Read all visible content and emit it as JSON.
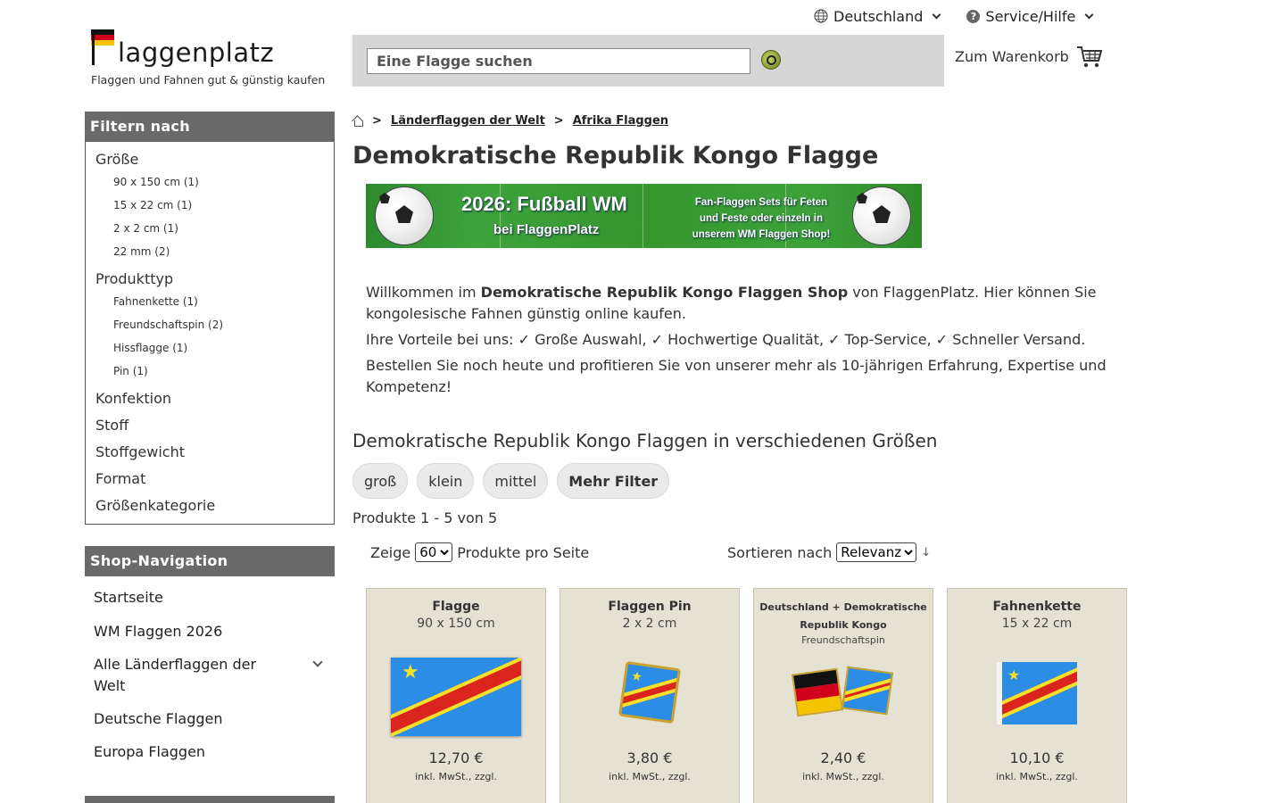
{
  "header": {
    "country_label": "Deutschland",
    "service_label": "Service/Hilfe",
    "help_glyph": "?",
    "logo_word": "laggenplatz",
    "logo_tagline": "Flaggen und Fahnen gut & günstig kaufen",
    "search_placeholder": "Eine Flagge suchen",
    "cart_label": "Zum Warenkorb"
  },
  "sidebar": {
    "filter_title": "Filtern nach",
    "filters": [
      {
        "label": "Größe",
        "options": [
          "90 x 150 cm (1)",
          "15 x 22 cm (1)",
          "2 x 2 cm (1)",
          "22 mm (2)"
        ]
      },
      {
        "label": "Produkttyp",
        "options": [
          "Fahnenkette (1)",
          "Freundschaftspin (2)",
          "Hissflagge (1)",
          "Pin (1)"
        ]
      },
      {
        "label": "Konfektion"
      },
      {
        "label": "Stoff"
      },
      {
        "label": "Stoffgewicht"
      },
      {
        "label": "Format"
      },
      {
        "label": "Größenkategorie"
      }
    ],
    "nav_title": "Shop-Navigation",
    "nav_items": [
      "Startseite",
      "WM Flaggen 2026",
      "Alle Länderflaggen der Welt",
      "Deutsche Flaggen",
      "Europa Flaggen"
    ]
  },
  "breadcrumb": {
    "sep": ">",
    "items": [
      "Länderflaggen der Welt",
      "Afrika Flaggen"
    ]
  },
  "page_title": "Demokratische Republik Kongo Flagge",
  "banner": {
    "headline": "2026: Fußball WM",
    "subline": "bei FlaggenPlatz",
    "side_text": "Fan-Flaggen Sets für Feten und Feste oder einzeln in unserem WM Flaggen Shop!"
  },
  "intro": {
    "p1_before": "Willkommen im ",
    "p1_bold": "Demokratische Republik Kongo Flaggen Shop",
    "p1_after": " von FlaggenPlatz. Hier können Sie kongolesische Fahnen günstig online kaufen.",
    "p2": "Ihre Vorteile bei uns: ✓ Große Auswahl, ✓ Hochwertige Qualität, ✓ Top-Service, ✓ Schneller Versand.",
    "p3": "Bestellen Sie noch heute und profitieren Sie von unserer mehr als 10-jährigen Erfahrung, Expertise und Kompetenz!"
  },
  "section_title": "Demokratische Republik Kongo Flaggen in verschiedenen Größen",
  "chips": [
    "groß",
    "klein",
    "mittel",
    "Mehr Filter"
  ],
  "results": {
    "count": "Produkte 1 - 5 von 5",
    "show_label": "Zeige",
    "per_page_value": "60",
    "per_page_suffix": "Produkte pro Seite",
    "sort_label": "Sortieren nach",
    "sort_value": "Relevanz",
    "sort_arrow": "↓"
  },
  "products": [
    {
      "title": "Flagge",
      "size": "90 x 150 cm",
      "price": "12,70 €",
      "vat": "inkl. MwSt., zzgl."
    },
    {
      "title": "Flaggen Pin",
      "size": "2 x 2 cm",
      "price": "3,80 €",
      "vat": "inkl. MwSt., zzgl."
    },
    {
      "title": "Deutschland + Demokratische Republik Kongo",
      "size": "Freundschaftspin",
      "price": "2,40 €",
      "vat": "inkl. MwSt., zzgl."
    },
    {
      "title": "Fahnenkette",
      "size": "15 x 22 cm",
      "price": "10,10 €",
      "vat": "inkl. MwSt., zzgl."
    }
  ],
  "colors": {
    "accent_green": "#2e8b3a",
    "panel_gray": "#6a6a6a",
    "card_bg": "#e6e2d3",
    "search_bg": "#d6d6d6"
  }
}
